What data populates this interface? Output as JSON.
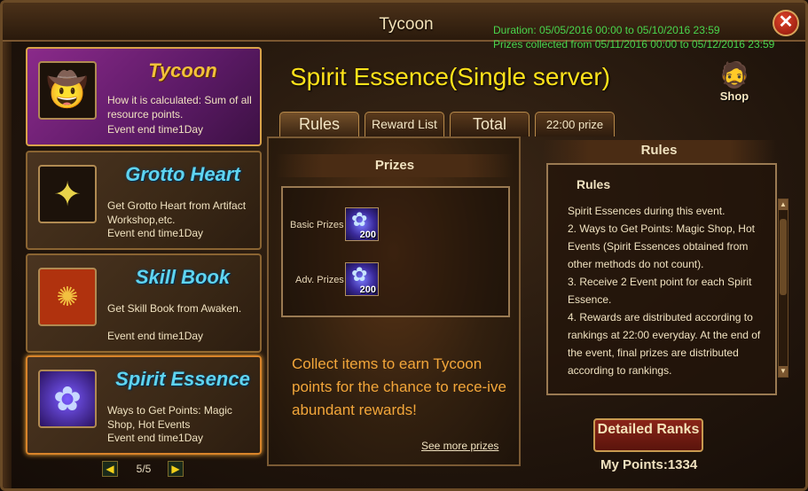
{
  "window": {
    "title": "Tycoon",
    "duration": "Duration: 05/05/2016 00:00 to 05/10/2016 23:59",
    "prizes_collected": "Prizes collected from 05/11/2016 00:00 to 05/12/2016 23:59",
    "close_label": "✕"
  },
  "events": [
    {
      "name": "Tycoon",
      "desc": "How it is calculated: Sum of all resource points.",
      "end": "Event end time1Day",
      "icon": "tycoon-portrait-icon"
    },
    {
      "name": "Grotto Heart",
      "desc": "Get Grotto Heart from Artifact Workshop,etc.",
      "end": "Event end time1Day",
      "icon": "crystal-icon"
    },
    {
      "name": "Skill Book",
      "desc": "Get Skill Book from Awaken.",
      "end": "Event end time1Day",
      "icon": "book-icon"
    },
    {
      "name": "Spirit Essence",
      "desc": "Ways to Get Points: Magic Shop, Hot Events",
      "end": "Event end time1Day",
      "icon": "spirit-essence-icon"
    }
  ],
  "pager": {
    "text": "5/5",
    "prev": "◀",
    "next": "▶"
  },
  "main": {
    "title": "Spirit Essence(Single server)",
    "shop_label": "Shop",
    "tabs": [
      "Rules",
      "Reward List",
      "Total",
      "22:00 prize"
    ]
  },
  "prizes": {
    "header": "Prizes",
    "basic_label": "Basic Prizes",
    "basic_qty": "200",
    "adv_label": "Adv. Prizes",
    "adv_qty": "200",
    "collect_text": "Collect items to earn Tycoon points for the chance to rece-ive abundant rewards!",
    "see_more": "See more prizes"
  },
  "rules": {
    "header": "Rules",
    "subtitle": "Rules",
    "lines": [
      "Spirit Essences during this event.",
      "2. Ways to Get Points: Magic Shop, Hot Events (Spirit Essences obtained from other methods do not count).",
      "3. Receive 2 Event point for each Spirit Essence.",
      "4. Rewards are distributed according to rankings at 22:00 everyday. At the end of the event, final prizes are distributed according to rankings."
    ]
  },
  "ranks": {
    "button_label": "Detailed Ranks",
    "my_points": "My Points:1334"
  }
}
